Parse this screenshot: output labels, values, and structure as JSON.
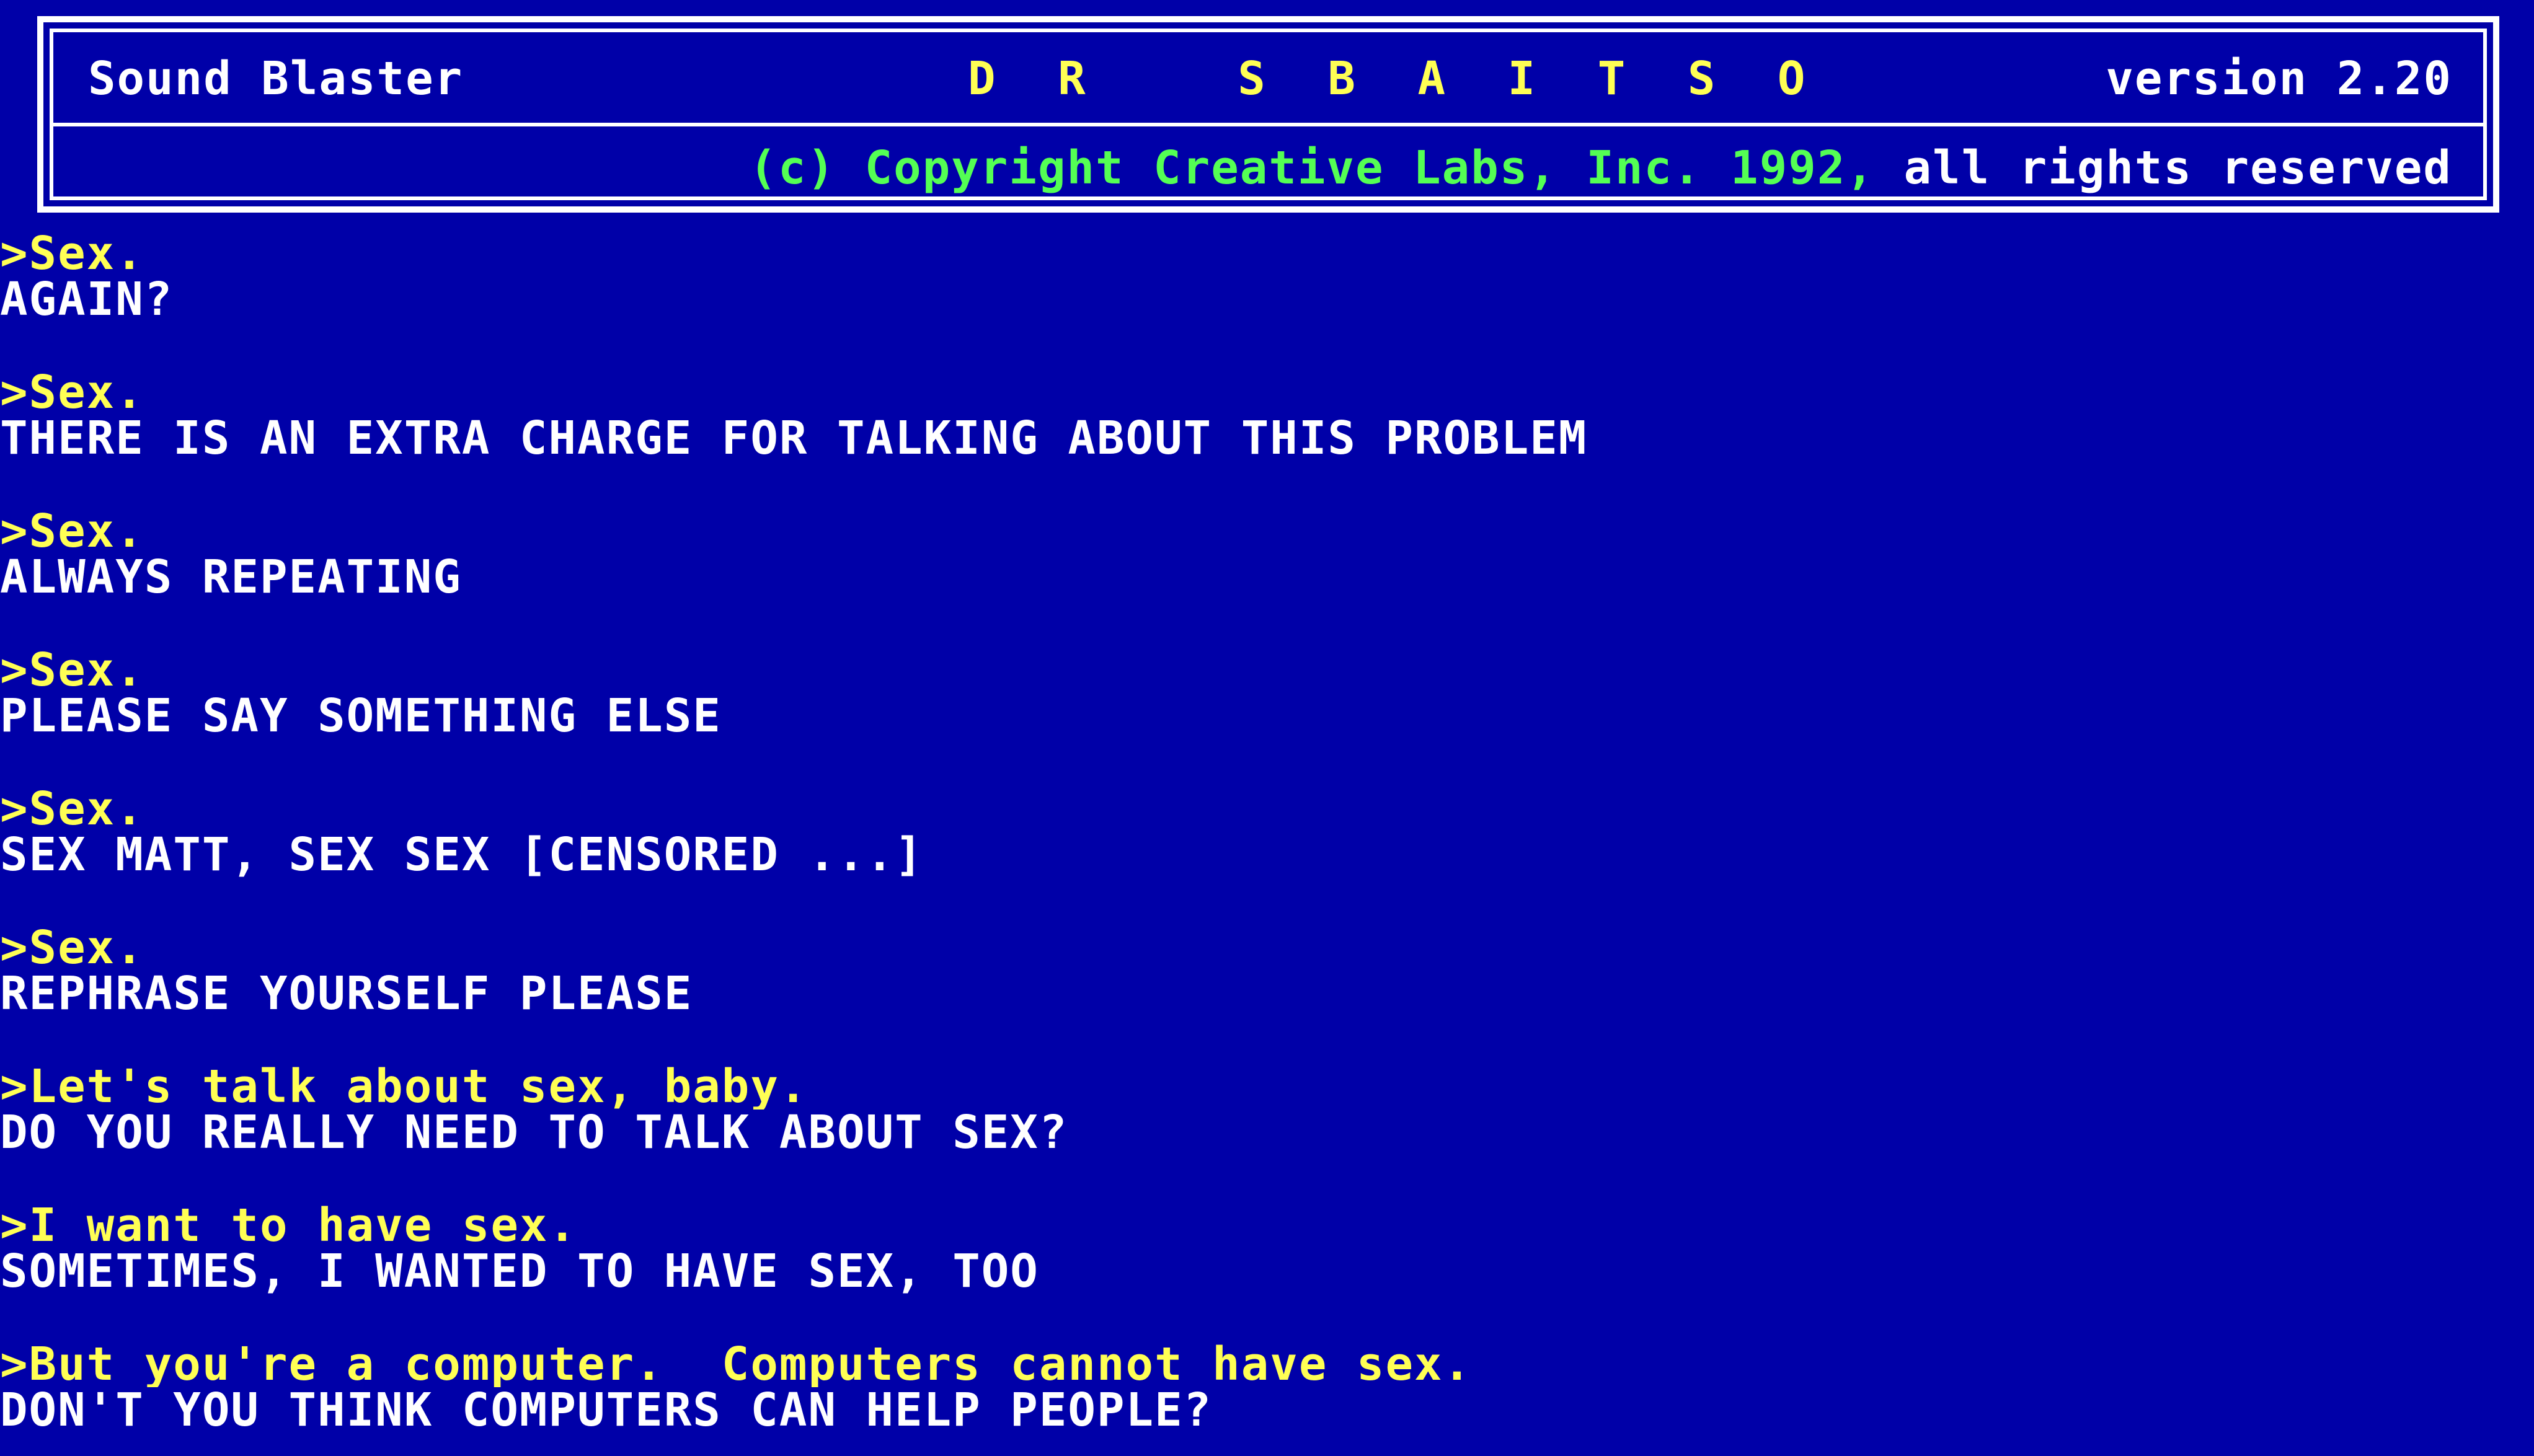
{
  "header": {
    "product": "Sound Blaster",
    "title": "D R   S B A I T S O",
    "version": "version 2.20",
    "copyright_green": "(c) Copyright Creative Labs, Inc. 1992,",
    "copyright_white": " all rights reserved"
  },
  "conversation": [
    {
      "user": ">Sex.",
      "reply": "AGAIN?"
    },
    {
      "user": ">Sex.",
      "reply": "THERE IS AN EXTRA CHARGE FOR TALKING ABOUT THIS PROBLEM"
    },
    {
      "user": ">Sex.",
      "reply": "ALWAYS REPEATING"
    },
    {
      "user": ">Sex.",
      "reply": "PLEASE SAY SOMETHING ELSE"
    },
    {
      "user": ">Sex.",
      "reply": "SEX MATT, SEX SEX [CENSORED ...]"
    },
    {
      "user": ">Sex.",
      "reply": "REPHRASE YOURSELF PLEASE"
    },
    {
      "user": ">Let's talk about sex, baby.",
      "reply": "DO YOU REALLY NEED TO TALK ABOUT SEX?"
    },
    {
      "user": ">I want to have sex.",
      "reply": "SOMETIMES, I WANTED TO HAVE SEX, TOO"
    },
    {
      "user": ">But you're a computer.  Computers cannot have sex.",
      "reply": "DON'T YOU THINK COMPUTERS CAN HELP PEOPLE?"
    }
  ],
  "colors": {
    "background": "#0000a8",
    "user_text": "#ffff54",
    "reply_text": "#ffffff",
    "copyright_text": "#54ff54",
    "title_text": "#ffff54"
  }
}
